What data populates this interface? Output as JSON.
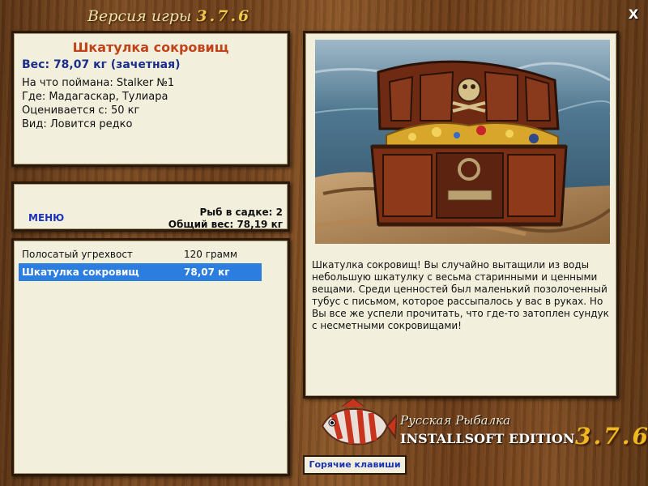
{
  "window": {
    "title_prefix": "Версия игры",
    "title_version": "3.7.6",
    "close_label": "X"
  },
  "catch_info": {
    "name": "Шкатулка сокровищ",
    "weight_line": "Вес: 78,07 кг (зачетная)",
    "caught_with": "На что поймана: Stalker №1",
    "location": "Где: Мадагаскар, Тулиара",
    "valued_from": "Оценивается с: 50 кг",
    "kind": "Вид: Ловится редко"
  },
  "stats": {
    "menu_label": "МЕНЮ",
    "fish_count": "Рыб в садке: 2",
    "total_weight": "Общий вес: 78,19 кг"
  },
  "catch_list": [
    {
      "name": "Полосатый угрехвост",
      "weight": "120 грамм",
      "selected": false
    },
    {
      "name": "Шкатулка сокровищ",
      "weight": "78,07 кг",
      "selected": true
    }
  ],
  "description": "Шкатулка сокровищ! Вы случайно вытащили из воды небольшую шкатулку с весьма старинными и ценными вещами. Среди ценностей был маленький позолоченный тубус с письмом, которое рассыпалось у вас в руках. Но Вы все же успели прочитать, что где-то затоплен сундук с несметными сокровищами!",
  "brand": {
    "line1": "Русская Рыбалка",
    "line2": "INSTALLSOFT EDITION",
    "version": "3.7.6"
  },
  "hotkeys_label": "Горячие клавиши",
  "icons": {
    "picture": "treasure-chest-image",
    "logo": "fish-logo-icon"
  },
  "colors": {
    "selected_row": "#2b7de0",
    "name_red": "#c0431a",
    "link_blue": "#1a33b8",
    "panel_bg": "#f3efdd"
  }
}
